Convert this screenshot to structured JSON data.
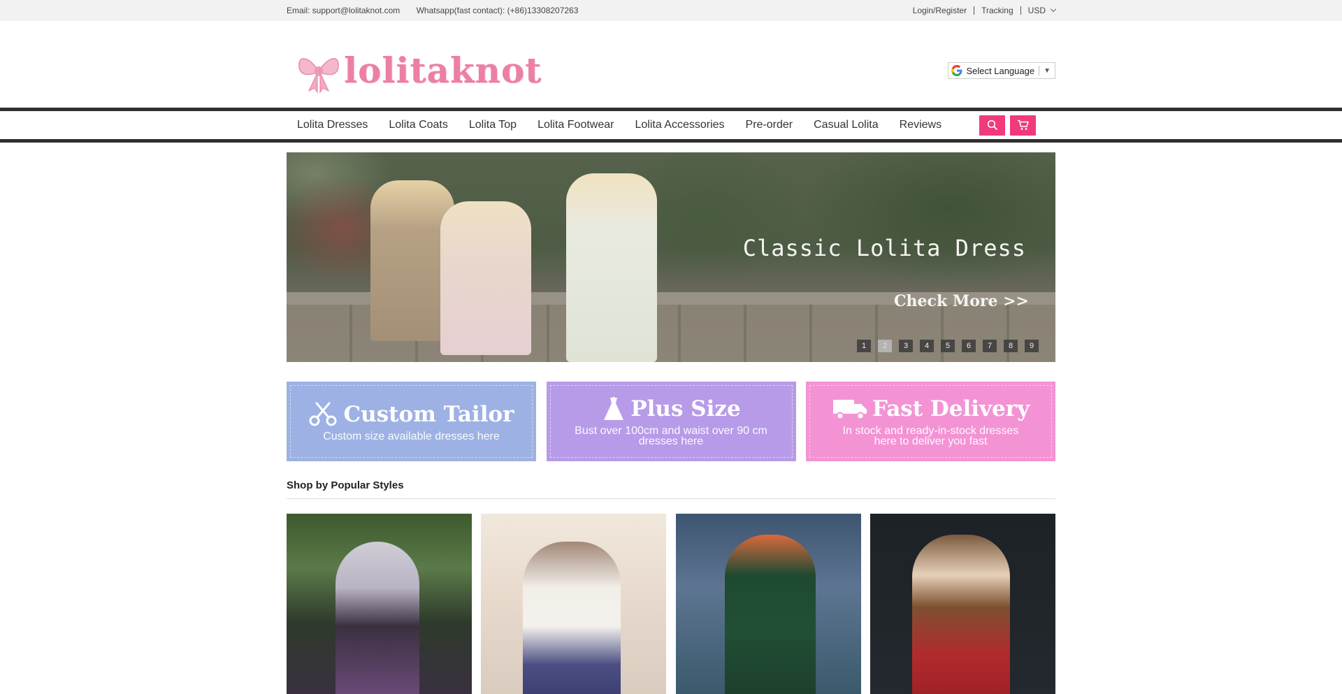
{
  "topbar": {
    "email": "Email: support@lolitaknot.com",
    "whatsapp": "Whatsapp(fast contact): (+86)13308207263",
    "login": "Login/Register",
    "tracking": "Tracking",
    "currency": "USD"
  },
  "header": {
    "logo_text": "lolitaknot",
    "language": "Select Language",
    "language_arrow": "▼"
  },
  "nav": {
    "items": [
      "Lolita Dresses",
      "Lolita Coats",
      "Lolita Top",
      "Lolita Footwear",
      "Lolita Accessories",
      "Pre-order",
      "Casual Lolita",
      "Reviews"
    ],
    "accent": "#f03a7e"
  },
  "banner": {
    "headline": "Classic Lolita Dress",
    "cta": "Check More >>",
    "pages": [
      "1",
      "2",
      "3",
      "4",
      "5",
      "6",
      "7",
      "8",
      "9"
    ],
    "active_page": "2"
  },
  "promos": [
    {
      "title": "Custom Tailor",
      "subtitle": "Custom size available dresses here",
      "icon": "scissors-icon",
      "color": "#9db1e4"
    },
    {
      "title": "Plus Size",
      "subtitle": "Bust over 100cm and waist over 90 cm dresses here",
      "icon": "dress-icon",
      "color": "#b79be8"
    },
    {
      "title": "Fast Delivery",
      "subtitle": "In stock and ready-in-stock dresses here to deliver you fast",
      "icon": "truck-icon",
      "color": "#f393d4"
    }
  ],
  "section": {
    "title": "Shop by Popular Styles"
  }
}
